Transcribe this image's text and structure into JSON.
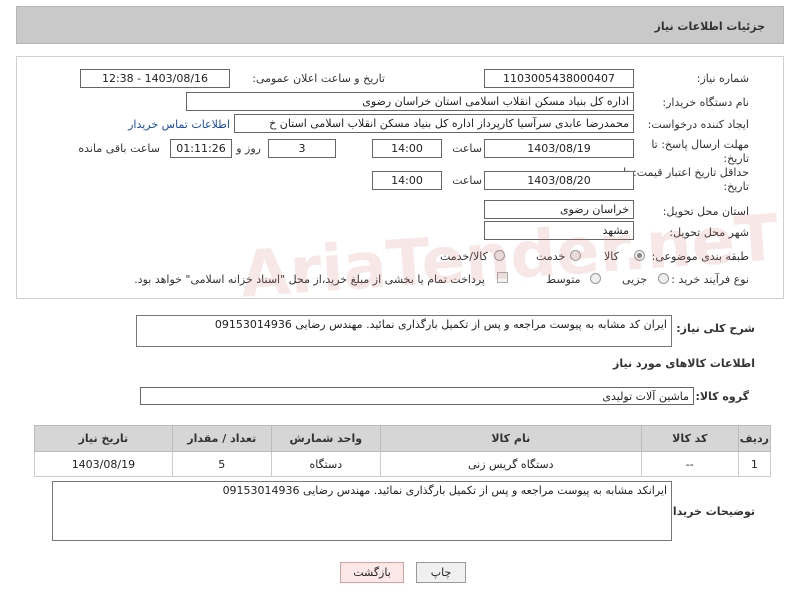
{
  "header": {
    "title": "جزئیات اطلاعات نیاز"
  },
  "fields": {
    "need_number_label": "شماره نیاز:",
    "need_number": "1103005438000407",
    "announce_label": "تاریخ و ساعت اعلان عمومی:",
    "announce_value": "1403/08/16 - 12:38",
    "buyer_org_label": "نام دستگاه خریدار:",
    "buyer_org": "اداره کل بنیاد مسکن انقلاب اسلامی استان خراسان رضوی",
    "creator_label": "ایجاد کننده درخواست:",
    "creator": "محمدرضا عابدی سرآسیا کارپرداز اداره کل بنیاد مسکن انقلاب اسلامی استان خ",
    "buyer_contact_link": "اطلاعات تماس خریدار",
    "deadline_label": "مهلت ارسال پاسخ: تا تاریخ:",
    "deadline_date": "1403/08/19",
    "time_label": "ساعت",
    "deadline_time": "14:00",
    "days_value": "3",
    "days_label": "روز و",
    "remaining_time": "01:11:26",
    "remaining_label": "ساعت باقی مانده",
    "validity_label": "حداقل تاریخ اعتبار قیمت: تا تاریخ:",
    "validity_date": "1403/08/20",
    "validity_time": "14:00",
    "province_label": "استان محل تحویل:",
    "province": "خراسان رضوی",
    "city_label": "شهر محل تحویل:",
    "city": "مشهد",
    "category_label": "طبقه بندی موضوعی:",
    "category_options": [
      "کالا",
      "خدمت",
      "کالا/خدمت"
    ],
    "process_label": "نوع فرآیند خرید :",
    "process_options": [
      "جزیی",
      "متوسط"
    ],
    "payment_text": "پرداخت تمام یا بخشی از مبلغ خرید،از محل \"اسناد خزانه اسلامی\" خواهد بود."
  },
  "description": {
    "label": "شرح کلی نیاز:",
    "text": "ایران کد مشابه به پیوست مراجعه و پس از تکمیل بارگذاری نمائید. مهندس رضایی 09153014936"
  },
  "goods": {
    "section_title": "اطلاعات کالاهای مورد نیاز",
    "group_label": "گروه کالا:",
    "group_value": "ماشین آلات تولیدی",
    "columns": [
      "ردیف",
      "کد کالا",
      "نام کالا",
      "واحد شمارش",
      "تعداد / مقدار",
      "تاریخ نیاز"
    ],
    "rows": [
      [
        "1",
        "--",
        "دستگاه گریس زنی",
        "دستگاه",
        "5",
        "1403/08/19"
      ]
    ]
  },
  "buyer_notes": {
    "label": "توضیحات خریدار:",
    "text": "ایرانکد مشابه به پیوست مراجعه و پس از تکمیل بارگذاری نمائید. مهندس رضایی 09153014936"
  },
  "buttons": {
    "print": "چاپ",
    "back": "بازگشت"
  },
  "watermark": "AriaTender.neT"
}
